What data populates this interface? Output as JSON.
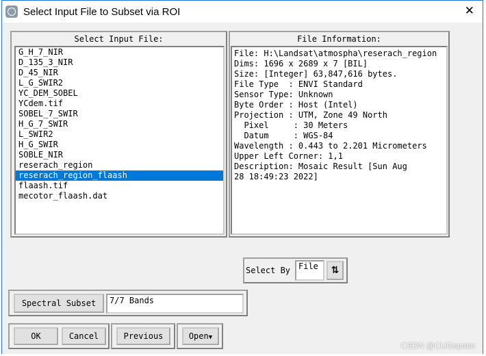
{
  "window": {
    "title": "Select Input File to Subset via ROI",
    "close_icon": "close-icon"
  },
  "input_panel": {
    "title": "Select Input File:",
    "files": [
      "G_H_7_NIR",
      "D_135_3_NIR",
      "D_45_NIR",
      "L_G_SWIR2",
      "YC_DEM_SOBEL",
      "YCdem.tif",
      "SOBEL_7_SWIR",
      "H_G_7_SWIR",
      "L_SWIR2",
      "H_G_SWIR",
      "SOBLE_NIR",
      "reserach_region",
      "reserach_region_flaash",
      "flaash.tif",
      "mecotor_flaash.dat"
    ],
    "selected": "reserach_region_flaash"
  },
  "info_panel": {
    "title": "File Information:",
    "lines": [
      "File: H:\\Landsat\\atmospha\\reserach_region",
      "Dims: 1696 x 2689 x 7 [BIL]",
      "Size: [Integer] 63,847,616 bytes.",
      "File Type  : ENVI Standard",
      "Sensor Type: Unknown",
      "Byte Order : Host (Intel)",
      "Projection : UTM, Zone 49 North",
      "  Pixel     : 30 Meters",
      "  Datum     : WGS-84",
      "Wavelength : 0.443 to 2.201 Micrometers",
      "Upper Left Corner: 1,1",
      "Description: Mosaic Result [Sun Aug",
      "28 18:49:23 2022]"
    ]
  },
  "select_by": {
    "label": "Select By",
    "value": "File",
    "toggle_icon": "sort-arrows-icon"
  },
  "spectral_subset": {
    "button": "Spectral Subset",
    "value": "7/7 Bands"
  },
  "buttons": {
    "ok": "OK",
    "cancel": "Cancel",
    "previous": "Previous",
    "open": "Open"
  },
  "watermark": "CSDN @CUGspatar",
  "colors": {
    "selection": "#0078d7",
    "window_border": "#1a78d6"
  }
}
